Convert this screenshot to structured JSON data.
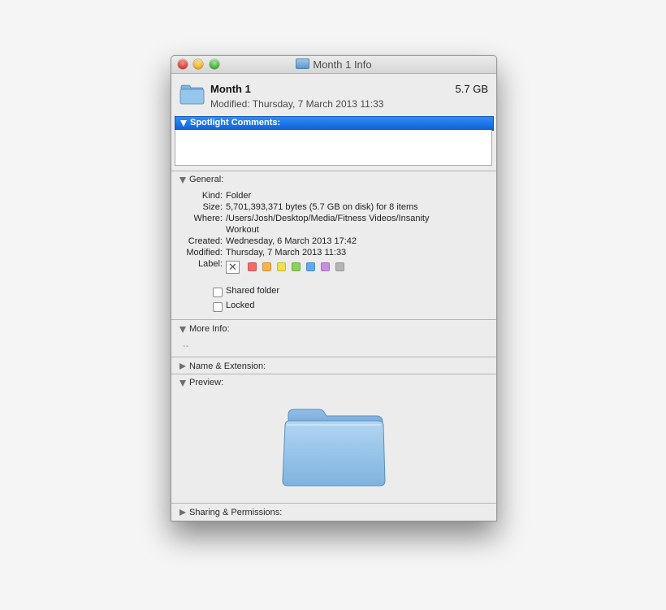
{
  "window": {
    "title": "Month 1 Info"
  },
  "summary": {
    "name": "Month 1",
    "modified": "Modified: Thursday, 7 March 2013 11:33",
    "size": "5.7 GB"
  },
  "sections": {
    "spotlight": "Spotlight Comments:",
    "general": "General:",
    "more_info": "More Info:",
    "name_ext": "Name & Extension:",
    "preview": "Preview:",
    "sharing": "Sharing & Permissions:"
  },
  "general": {
    "kind_key": "Kind:",
    "kind_val": "Folder",
    "size_key": "Size:",
    "size_val": "5,701,393,371 bytes (5.7 GB on disk) for 8 items",
    "where_key": "Where:",
    "where_val_1": "/Users/Josh/Desktop/Media/Fitness Videos/Insanity",
    "where_val_2": "Workout",
    "created_key": "Created:",
    "created_val": "Wednesday, 6 March 2013 17:42",
    "modified_key": "Modified:",
    "modified_val": "Thursday, 7 March 2013 11:33",
    "label_key": "Label:",
    "label_none_glyph": "✕",
    "label_colors": [
      "#f26a6a",
      "#f7b44a",
      "#efe14a",
      "#8fd15a",
      "#5ea9ef",
      "#c98ee0",
      "#b5b5b5"
    ],
    "shared_folder": "Shared folder",
    "shared_folder_checked": false,
    "locked": "Locked",
    "locked_checked": false
  },
  "more_info": {
    "placeholder": "--"
  },
  "colors": {
    "selection_blue": "#1a6ae3",
    "folder_blue": "#8ec0e8"
  }
}
